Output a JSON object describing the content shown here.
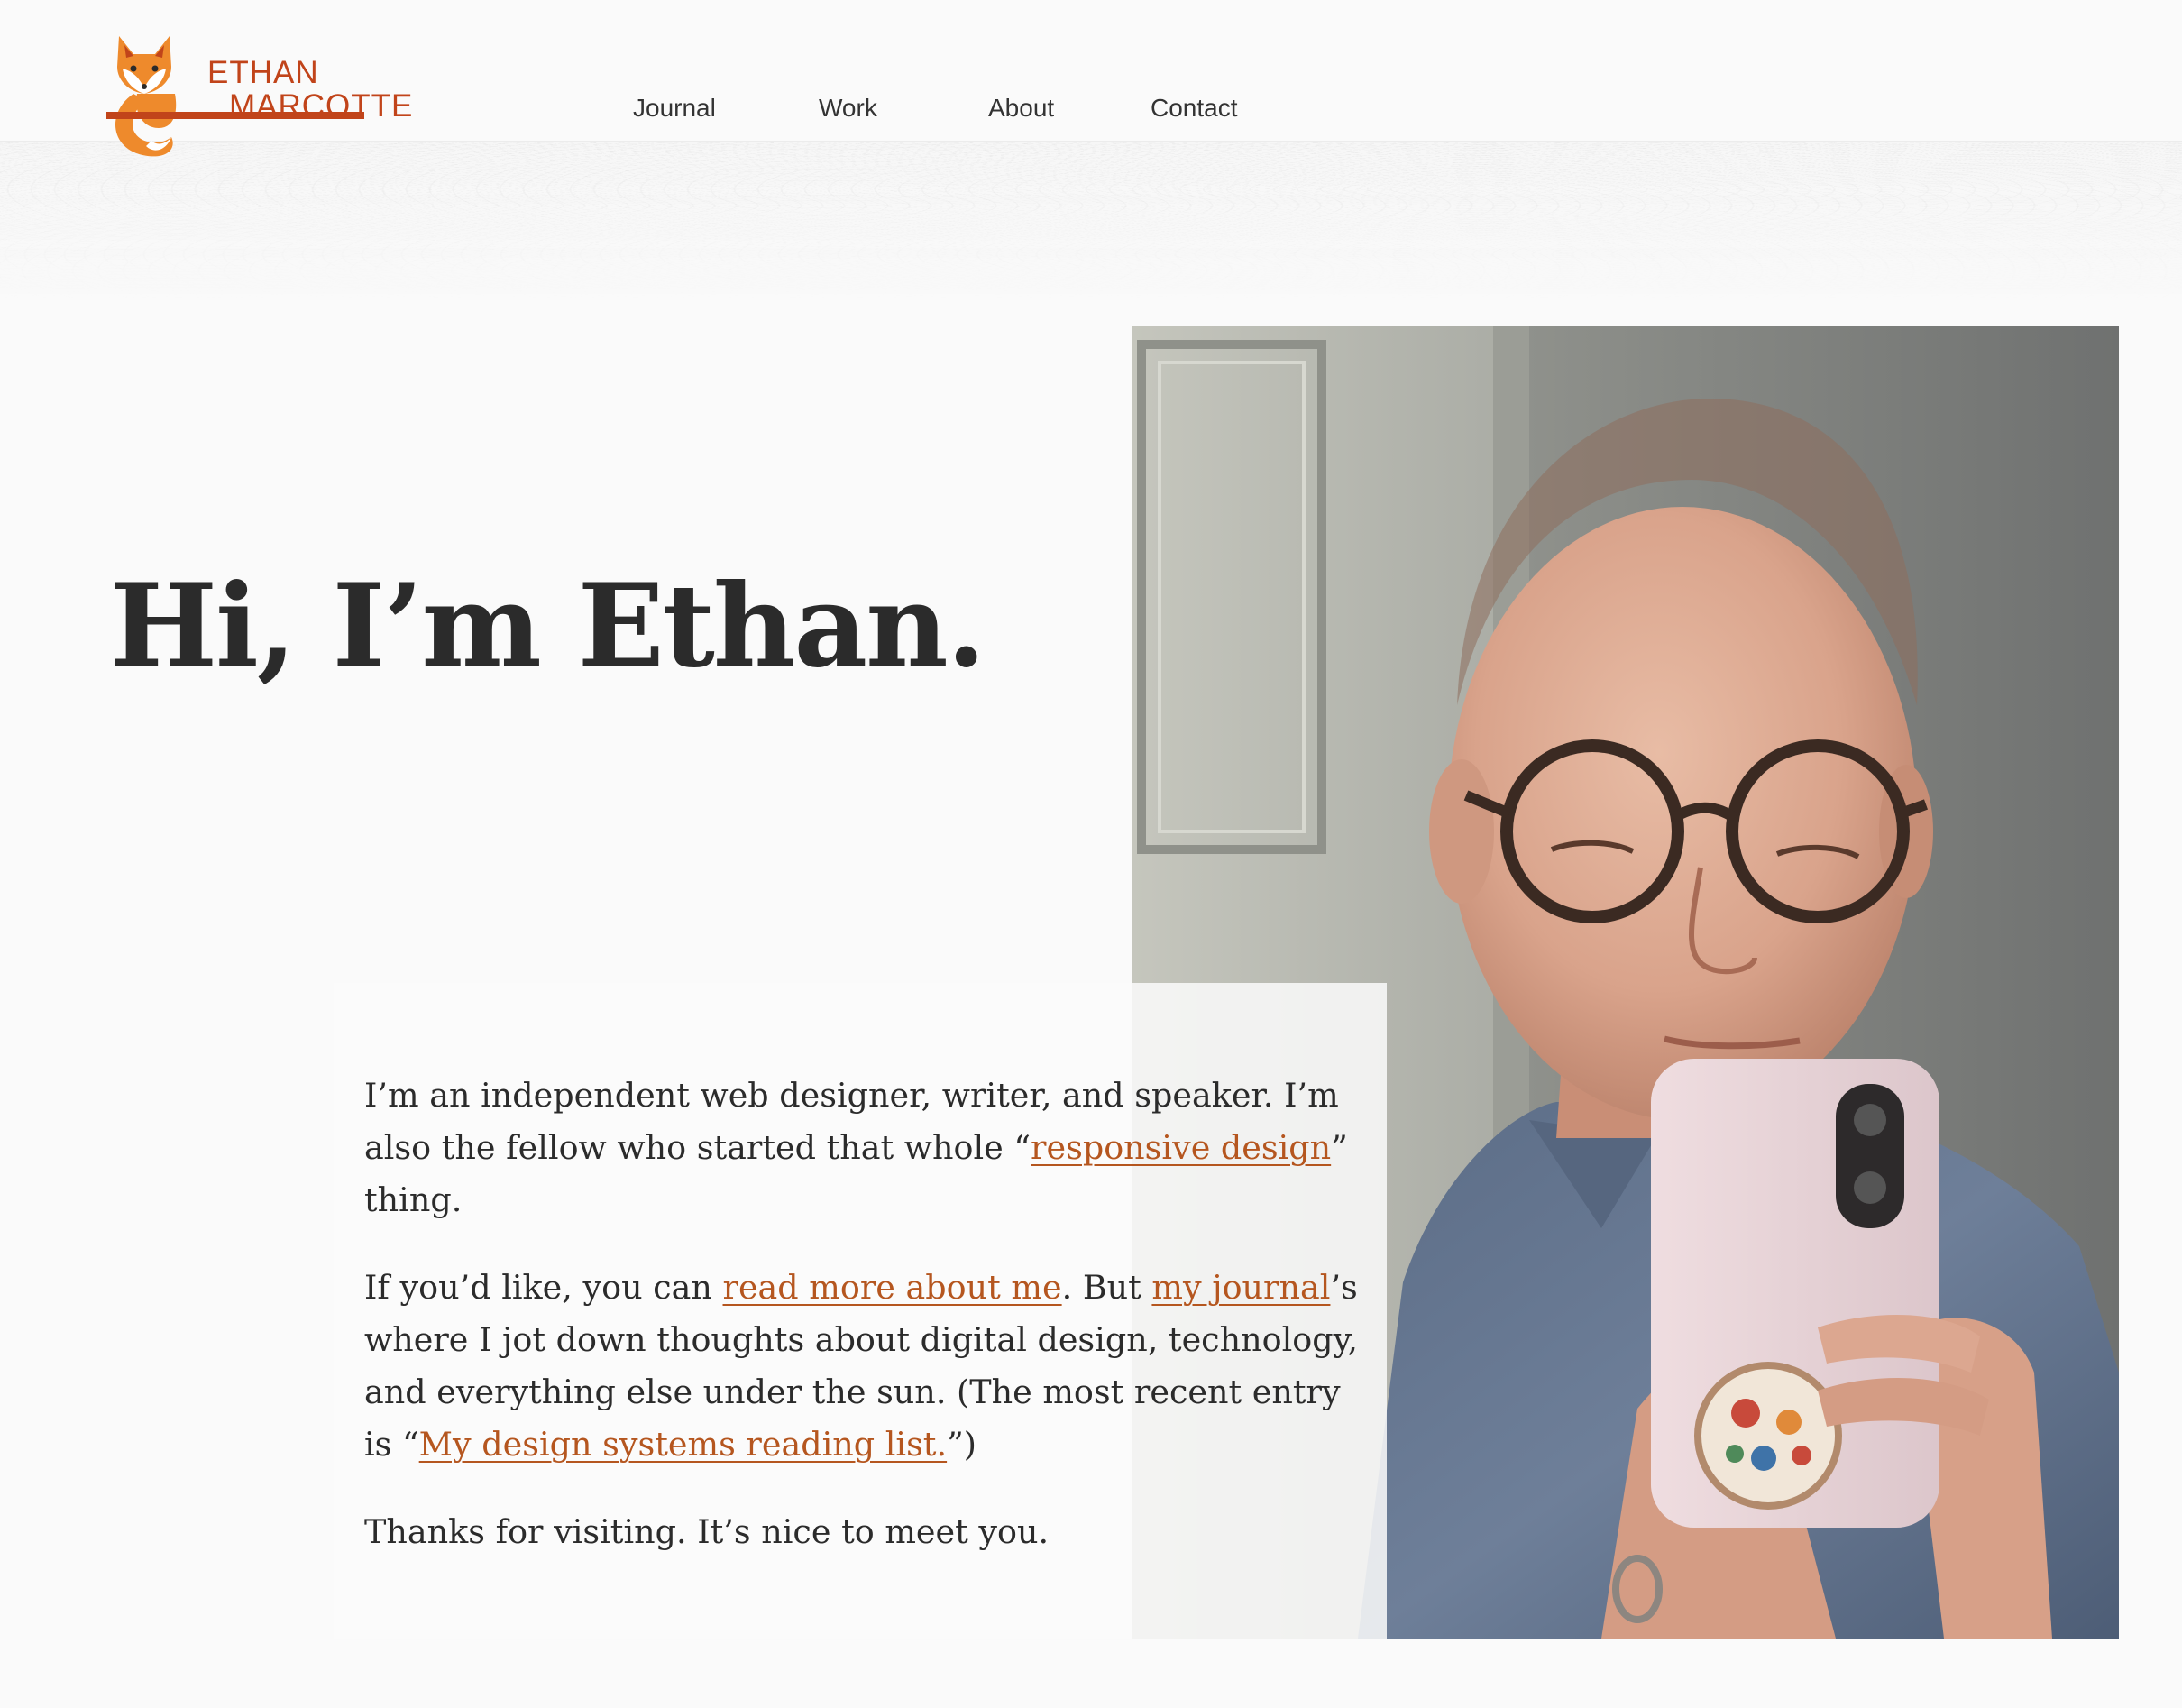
{
  "site": {
    "logo": {
      "line1": "ETHAN",
      "line2": "MARCOTTE",
      "icon": "fox-icon",
      "color": "#c1441a",
      "secondary_color": "#ee8a2c"
    }
  },
  "nav": {
    "items": [
      {
        "label": "Journal"
      },
      {
        "label": "Work"
      },
      {
        "label": "About"
      },
      {
        "label": "Contact"
      }
    ]
  },
  "hero": {
    "headline": "Hi, I’m Ethan.",
    "photo": {
      "subject": "portrait-photo",
      "icons": [
        "phone-icon",
        "popsocket-icon"
      ]
    }
  },
  "intro": {
    "p1": {
      "t1": "I’m an independent web designer, writer, and speaker. I’m also the fellow who started that whole “",
      "link1": "responsive design",
      "t2": "” thing."
    },
    "p2": {
      "t1": "If you’d like, you can ",
      "link1": "read more about me",
      "t2": ". But ",
      "link2": "my journal",
      "t3": "’s where I jot down thoughts about digital design, technology, and everything else under the sun. (The most recent entry is “",
      "link3": "My design systems reading list.",
      "t4": "”)"
    },
    "p3": {
      "t1": "Thanks for visiting. It’s nice to meet you."
    }
  },
  "colors": {
    "link": "#b5561f",
    "text": "#2b2b2b",
    "background": "#fafafa"
  }
}
